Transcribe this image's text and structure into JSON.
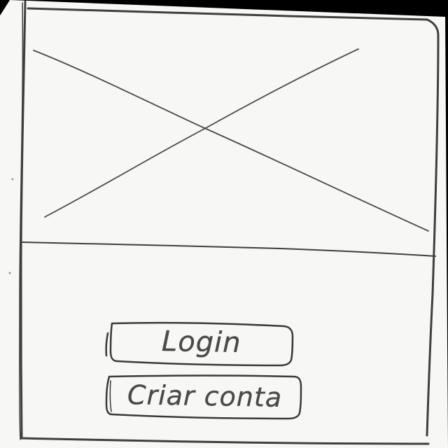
{
  "screen": {
    "image_placeholder": {
      "icon": "image-placeholder-icon"
    },
    "buttons": {
      "login_label": "Login",
      "create_account_label": "Criar conta"
    }
  },
  "colors": {
    "background": "#000000",
    "paper": "#f7f7f5",
    "pencil": "#4a4a4a"
  }
}
